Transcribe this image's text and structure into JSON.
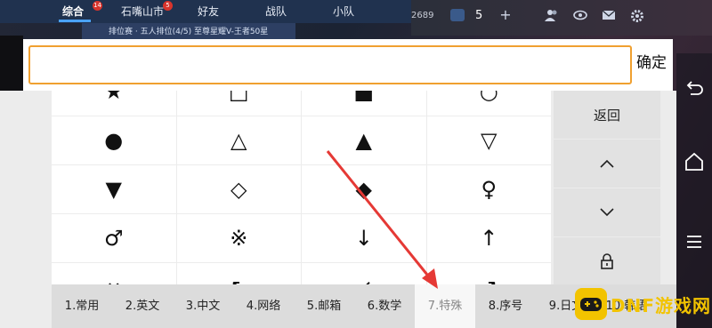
{
  "game": {
    "tabs": [
      {
        "label": "综合",
        "badge": "14"
      },
      {
        "label": "石嘴山市",
        "badge": "5"
      },
      {
        "label": "好友",
        "badge": ""
      },
      {
        "label": "战队",
        "badge": ""
      },
      {
        "label": "小队",
        "badge": ""
      }
    ],
    "banner_text": "排位赛 · 五人排位(4/5)  至尊星耀V-王者50星",
    "hud_number": "2689",
    "hud_count": "5"
  },
  "input": {
    "value": "",
    "placeholder": "",
    "confirm_label": "确定"
  },
  "keyboard": {
    "symbols": [
      [
        "★",
        "□",
        "■",
        "○"
      ],
      [
        "●",
        "△",
        "▲",
        "▽"
      ],
      [
        "▼",
        "◇",
        "◆",
        "♀"
      ],
      [
        "♂",
        "※",
        "↓",
        "↑"
      ],
      [
        "↔",
        "↖",
        "↙",
        "↗"
      ]
    ],
    "side": {
      "back_label": "返回",
      "up_icon": "chevron-up-icon",
      "down_icon": "chevron-down-icon",
      "lock_icon": "lock-icon"
    },
    "categories": [
      {
        "label": "1.常用",
        "active": false
      },
      {
        "label": "2.英文",
        "active": false
      },
      {
        "label": "3.中文",
        "active": false
      },
      {
        "label": "4.网络",
        "active": false
      },
      {
        "label": "5.邮箱",
        "active": false
      },
      {
        "label": "6.数学",
        "active": false
      },
      {
        "label": "7.特殊",
        "active": true
      },
      {
        "label": "8.序号",
        "active": false
      },
      {
        "label": "9.日文",
        "active": false
      },
      {
        "label": "10.韩语",
        "active": false
      }
    ]
  },
  "annotation": {
    "color": "#e53935"
  },
  "watermark": {
    "text": "DNF游戏网",
    "color": "#f2c300"
  },
  "colors": {
    "input_border": "#f0a030",
    "active_tab_text": "#888888"
  }
}
